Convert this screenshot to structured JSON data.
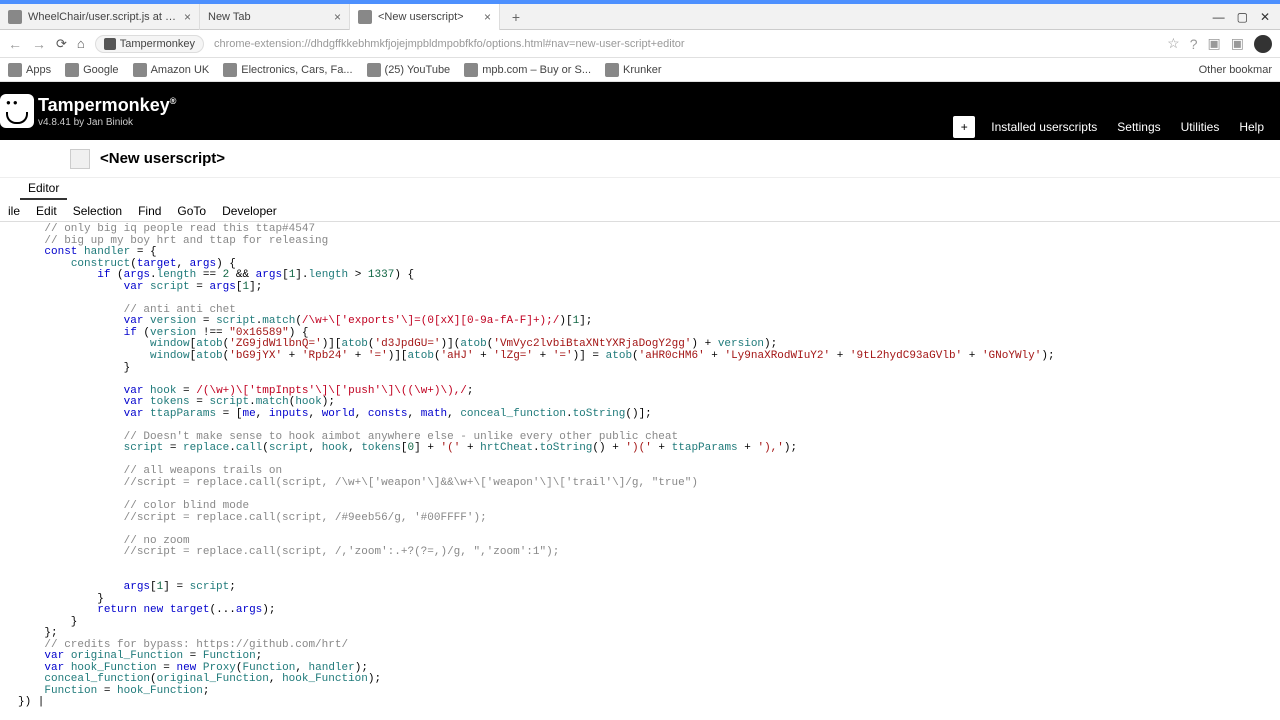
{
  "browser": {
    "tabs": [
      {
        "title": "WheelChair/user.script.js at mas...",
        "closeable": true
      },
      {
        "title": "New Tab",
        "closeable": true
      },
      {
        "title": "<New userscript>",
        "closeable": true,
        "active": true
      }
    ],
    "new_tab": "+",
    "win": {
      "min": "—",
      "max": "▢",
      "close": "✕"
    }
  },
  "url_bar": {
    "ext_name": "Tampermonkey",
    "url": "chrome-extension://dhdgffkkebhmkfjojejmpbldmpobfkfo/options.html#nav=new-user-script+editor"
  },
  "bookmarks": {
    "items": [
      "Apps",
      "Google",
      "Amazon UK",
      "Electronics, Cars, Fa...",
      "(25) YouTube",
      "mpb.com – Buy or S...",
      "Krunker"
    ],
    "right": "Other bookmar"
  },
  "tm": {
    "name": "Tampermonkey",
    "reg": "®",
    "version": "v4.8.41 by Jan Biniok",
    "nav": {
      "plus": "+",
      "installed": "Installed userscripts",
      "settings": "Settings",
      "utilities": "Utilities",
      "help": "Help"
    }
  },
  "script": {
    "title": "<New userscript>",
    "tab": "Editor"
  },
  "editor_menu": [
    "ile",
    "Edit",
    "Selection",
    "Find",
    "GoTo",
    "Developer"
  ],
  "code_lines": [
    {
      "i": "    ",
      "html": "<span class='c-com'>// only big iq people read this ttap#4547</span>"
    },
    {
      "i": "    ",
      "html": "<span class='c-com'>// big up my boy hrt and ttap for releasing</span>"
    },
    {
      "i": "    ",
      "html": "<span class='c-kw'>const</span> <span class='c-prop'>handler</span> = {"
    },
    {
      "i": "        ",
      "html": "<span class='c-prop'>construct</span>(<span class='c-def'>target</span>, <span class='c-def'>args</span>) {"
    },
    {
      "i": "            ",
      "html": "<span class='c-kw'>if</span> (<span class='c-def'>args</span>.<span class='c-prop'>length</span> == <span class='c-num'>2</span> &amp;&amp; <span class='c-def'>args</span>[<span class='c-num'>1</span>].<span class='c-prop'>length</span> &gt; <span class='c-num'>1337</span>) {"
    },
    {
      "i": "                ",
      "html": "<span class='c-kw'>var</span> <span class='c-prop'>script</span> = <span class='c-def'>args</span>[<span class='c-num'>1</span>];"
    },
    {
      "i": "",
      "html": ""
    },
    {
      "i": "                ",
      "html": "<span class='c-com'>// anti anti chet</span>"
    },
    {
      "i": "                ",
      "html": "<span class='c-kw'>var</span> <span class='c-prop'>version</span> = <span class='c-prop'>script</span>.<span class='c-prop'>match</span>(<span class='c-regex'>/\\w+\\['exports'\\]=(0[xX][0-9a-fA-F]+);/</span>)[<span class='c-num'>1</span>];"
    },
    {
      "i": "                ",
      "html": "<span class='c-kw'>if</span> (<span class='c-prop'>version</span> !== <span class='c-str'>\"0x16589\"</span>) {"
    },
    {
      "i": "                    ",
      "html": "<span class='c-prop'>window</span>[<span class='c-prop'>atob</span>(<span class='c-str'>'ZG9jdW1lbnQ='</span>)][<span class='c-prop'>atob</span>(<span class='c-str'>'d3JpdGU='</span>)](<span class='c-prop'>atob</span>(<span class='c-str'>'VmVyc2lvbiBtaXNtYXRjaDogY2gg'</span>) + <span class='c-prop'>version</span>);"
    },
    {
      "i": "                    ",
      "html": "<span class='c-prop'>window</span>[<span class='c-prop'>atob</span>(<span class='c-str'>'bG9jYX'</span> + <span class='c-str'>'Rpb24'</span> + <span class='c-str'>'='</span>)][<span class='c-prop'>atob</span>(<span class='c-str'>'aHJ'</span> + <span class='c-str'>'lZg='</span> + <span class='c-str'>'='</span>)] = <span class='c-prop'>atob</span>(<span class='c-str'>'aHR0cHM6'</span> + <span class='c-str'>'Ly9naXRodWIuY2'</span> + <span class='c-str'>'9tL2hydC93aGVlb'</span> + <span class='c-str'>'GNoYWly'</span>);"
    },
    {
      "i": "                ",
      "html": "}"
    },
    {
      "i": "",
      "html": ""
    },
    {
      "i": "                ",
      "html": "<span class='c-kw'>var</span> <span class='c-prop'>hook</span> = <span class='c-regex'>/(\\w+)\\['tmpInpts'\\]\\['push'\\]\\((\\w+)\\),/</span>;"
    },
    {
      "i": "                ",
      "html": "<span class='c-kw'>var</span> <span class='c-prop'>tokens</span> = <span class='c-prop'>script</span>.<span class='c-prop'>match</span>(<span class='c-prop'>hook</span>);"
    },
    {
      "i": "                ",
      "html": "<span class='c-kw'>var</span> <span class='c-prop'>ttapParams</span> = [<span class='c-def'>me</span>, <span class='c-def'>inputs</span>, <span class='c-def'>world</span>, <span class='c-def'>consts</span>, <span class='c-def'>math</span>, <span class='c-prop'>conceal_function</span>.<span class='c-prop'>toString</span>()];"
    },
    {
      "i": "",
      "html": ""
    },
    {
      "i": "                ",
      "html": "<span class='c-com'>// Doesn't make sense to hook aimbot anywhere else - unlike every other public cheat</span>"
    },
    {
      "i": "                ",
      "html": "<span class='c-prop'>script</span> = <span class='c-prop'>replace</span>.<span class='c-prop'>call</span>(<span class='c-prop'>script</span>, <span class='c-prop'>hook</span>, <span class='c-prop'>tokens</span>[<span class='c-num'>0</span>] + <span class='c-str'>'('</span> + <span class='c-prop'>hrtCheat</span>.<span class='c-prop'>toString</span>() + <span class='c-str'>')('</span> + <span class='c-prop'>ttapParams</span> + <span class='c-str'>'),'</span>);"
    },
    {
      "i": "",
      "html": ""
    },
    {
      "i": "                ",
      "html": "<span class='c-com'>// all weapons trails on</span>"
    },
    {
      "i": "                ",
      "html": "<span class='c-com'>//script = replace.call(script, /\\w+\\['weapon'\\]&amp;&amp;\\w+\\['weapon'\\]\\['trail'\\]/g, \"true\")</span>"
    },
    {
      "i": "",
      "html": ""
    },
    {
      "i": "                ",
      "html": "<span class='c-com'>// color blind mode</span>"
    },
    {
      "i": "                ",
      "html": "<span class='c-com'>//script = replace.call(script, /#9eeb56/g, '#00FFFF');</span>"
    },
    {
      "i": "",
      "html": ""
    },
    {
      "i": "                ",
      "html": "<span class='c-com'>// no zoom</span>"
    },
    {
      "i": "                ",
      "html": "<span class='c-com'>//script = replace.call(script, /,'zoom':.+?(?=,)/g, \",'zoom':1\");</span>"
    },
    {
      "i": "",
      "html": ""
    },
    {
      "i": "",
      "html": ""
    },
    {
      "i": "                ",
      "html": "<span class='c-def'>args</span>[<span class='c-num'>1</span>] = <span class='c-prop'>script</span>;"
    },
    {
      "i": "            ",
      "html": "}"
    },
    {
      "i": "            ",
      "html": "<span class='c-kw'>return</span> <span class='c-kw'>new</span> <span class='c-def'>target</span>(...<span class='c-def'>args</span>);"
    },
    {
      "i": "        ",
      "html": "}"
    },
    {
      "i": "    ",
      "html": "};"
    },
    {
      "i": "    ",
      "html": "<span class='c-com'>// credits for bypass: https://github.com/hrt/</span>"
    },
    {
      "i": "    ",
      "html": "<span class='c-kw'>var</span> <span class='c-prop'>original_Function</span> = <span class='c-prop'>Function</span>;"
    },
    {
      "i": "    ",
      "html": "<span class='c-kw'>var</span> <span class='c-prop'>hook_Function</span> = <span class='c-kw'>new</span> <span class='c-prop'>Proxy</span>(<span class='c-prop'>Function</span>, <span class='c-prop'>handler</span>);"
    },
    {
      "i": "    ",
      "html": "<span class='c-prop'>conceal_function</span>(<span class='c-prop'>original_Function</span>, <span class='c-prop'>hook_Function</span>);"
    },
    {
      "i": "    ",
      "html": "<span class='c-prop'>Function</span> = <span class='c-prop'>hook_Function</span>;"
    },
    {
      "i": "",
      "html": "}) |"
    }
  ],
  "line_numbers_start": 3
}
